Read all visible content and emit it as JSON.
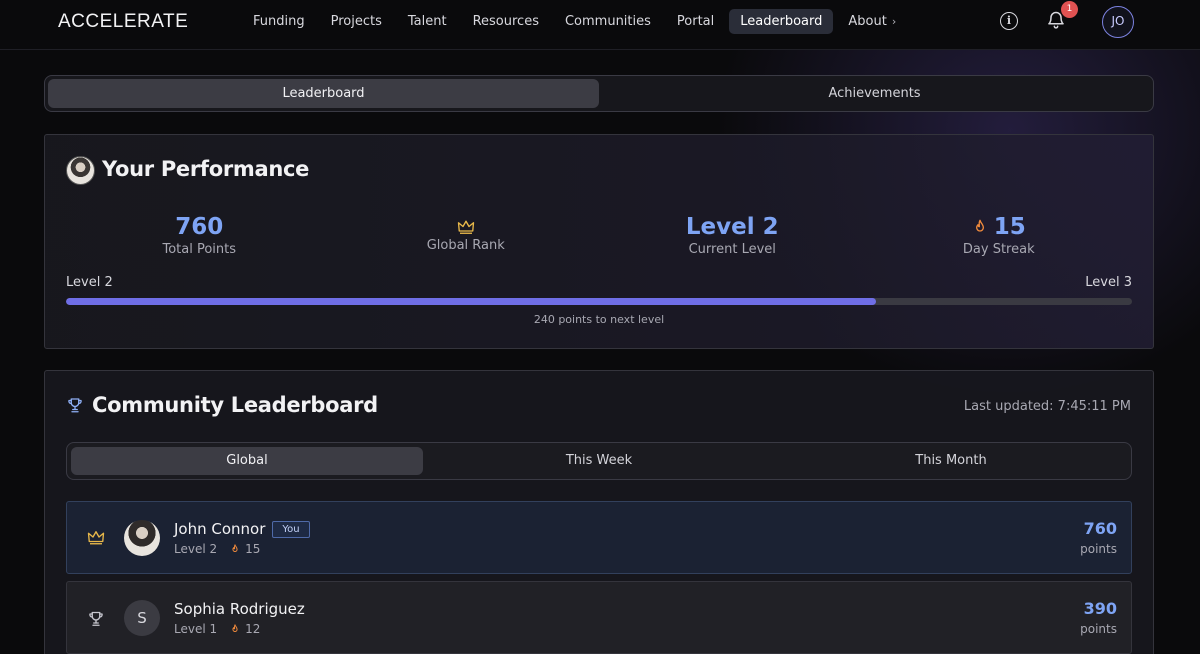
{
  "brand": "ACCELERATE",
  "nav": [
    {
      "label": "Funding"
    },
    {
      "label": "Projects"
    },
    {
      "label": "Talent"
    },
    {
      "label": "Resources"
    },
    {
      "label": "Communities"
    },
    {
      "label": "Portal"
    },
    {
      "label": "Leaderboard",
      "active": true
    },
    {
      "label": "About",
      "has_chevron": true
    }
  ],
  "header": {
    "notification_count": "1",
    "user_initials": "JO"
  },
  "main_tabs": [
    {
      "label": "Leaderboard",
      "active": true
    },
    {
      "label": "Achievements"
    }
  ],
  "performance": {
    "title": "Your Performance",
    "total_points": "760",
    "total_points_label": "Total Points",
    "global_rank_label": "Global Rank",
    "current_level": "Level 2",
    "current_level_label": "Current Level",
    "day_streak": "15",
    "day_streak_label": "Day Streak",
    "progress_from": "Level 2",
    "progress_to": "Level 3",
    "progress_fraction": 0.76,
    "progress_note": "240 points to next level"
  },
  "community": {
    "title": "Community Leaderboard",
    "last_updated": "Last updated: 7:45:11 PM",
    "tabs": [
      {
        "label": "Global",
        "active": true
      },
      {
        "label": "This Week"
      },
      {
        "label": "This Month"
      }
    ],
    "rows": [
      {
        "rank_icon": "crown-icon",
        "avatar": "photo",
        "name": "John Connor",
        "badge": "You",
        "level": "Level 2",
        "streak": "15",
        "points": "760",
        "points_label": "points"
      },
      {
        "rank_icon": "trophy-icon",
        "avatar_letter": "S",
        "name": "Sophia Rodriguez",
        "level": "Level 1",
        "streak": "12",
        "points": "390",
        "points_label": "points"
      }
    ]
  },
  "colors": {
    "accent_blue": "#7ea4f4",
    "progress_fill": "#6f6ee6",
    "crown_gold": "#e8b84a",
    "flame_orange": "#f08a3c",
    "badge_red": "#e05252"
  }
}
